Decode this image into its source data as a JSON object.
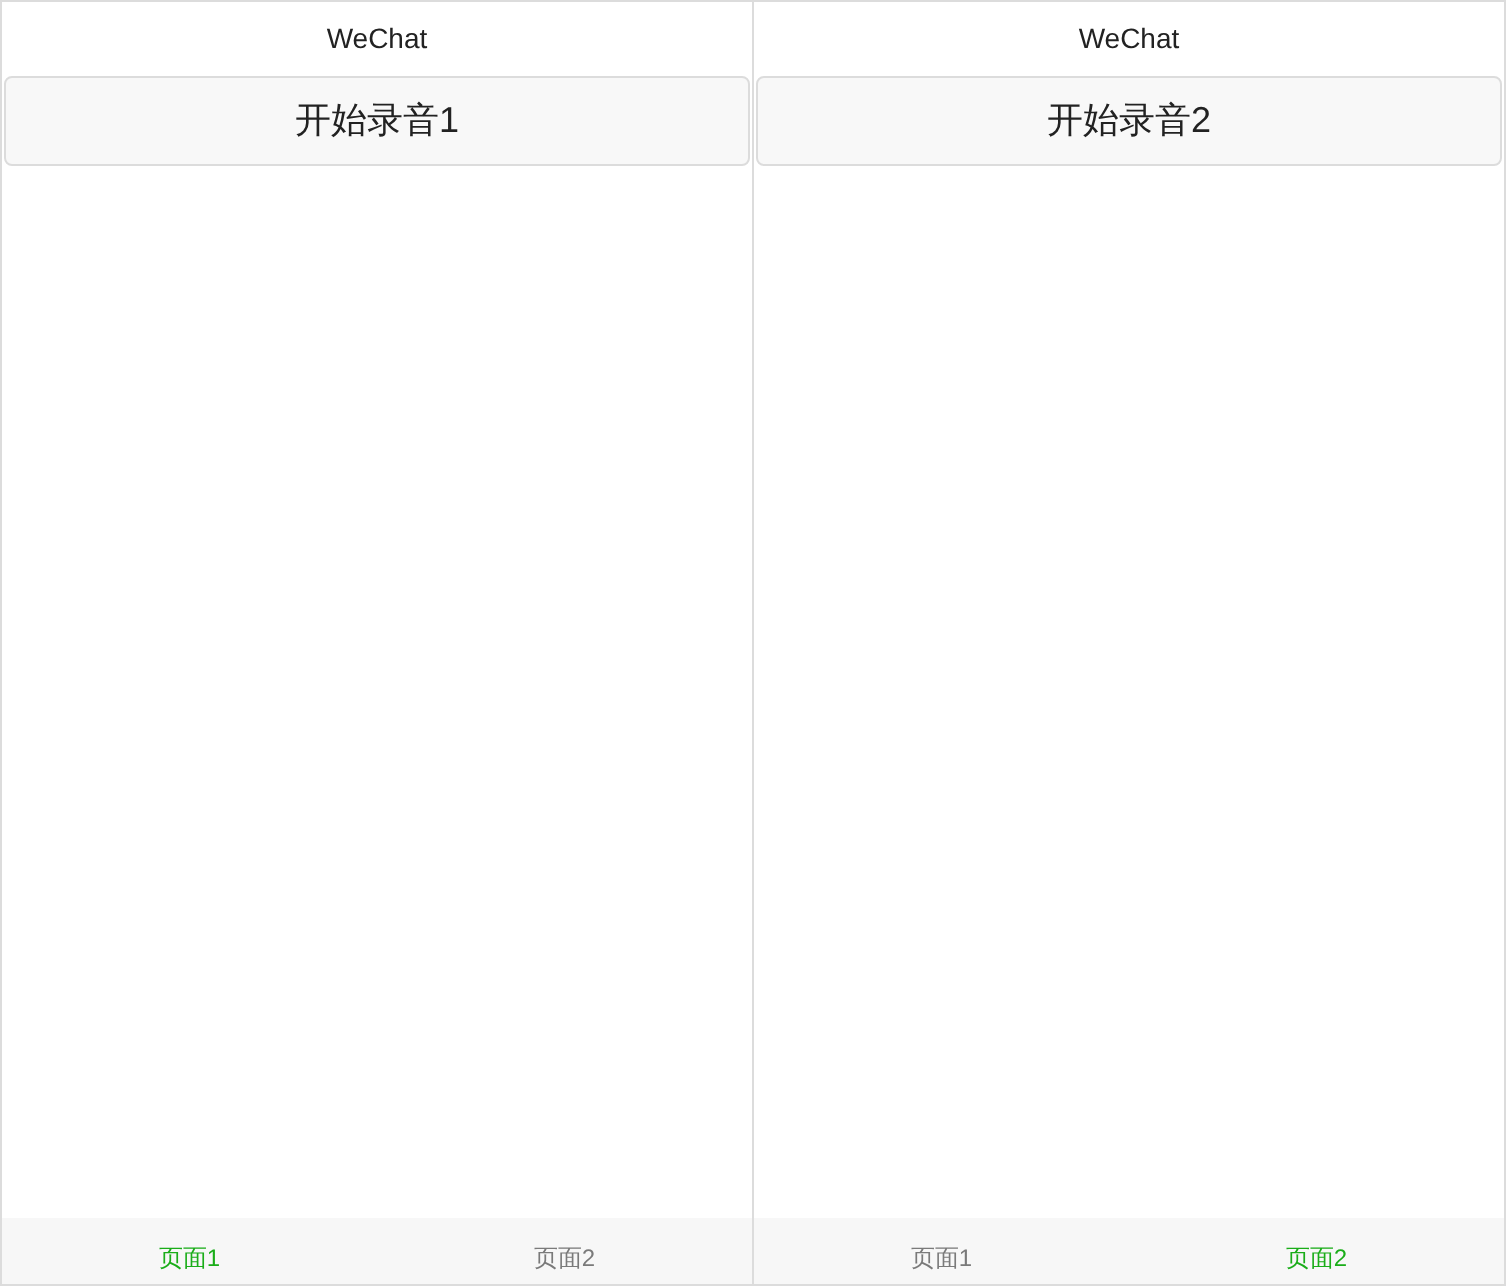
{
  "phones": [
    {
      "title": "WeChat",
      "button": "开始录音1",
      "tabs": [
        {
          "label": "页面1",
          "selected": true
        },
        {
          "label": "页面2",
          "selected": false
        }
      ]
    },
    {
      "title": "WeChat",
      "button": "开始录音2",
      "tabs": [
        {
          "label": "页面1",
          "selected": false
        },
        {
          "label": "页面2",
          "selected": true
        }
      ]
    }
  ]
}
